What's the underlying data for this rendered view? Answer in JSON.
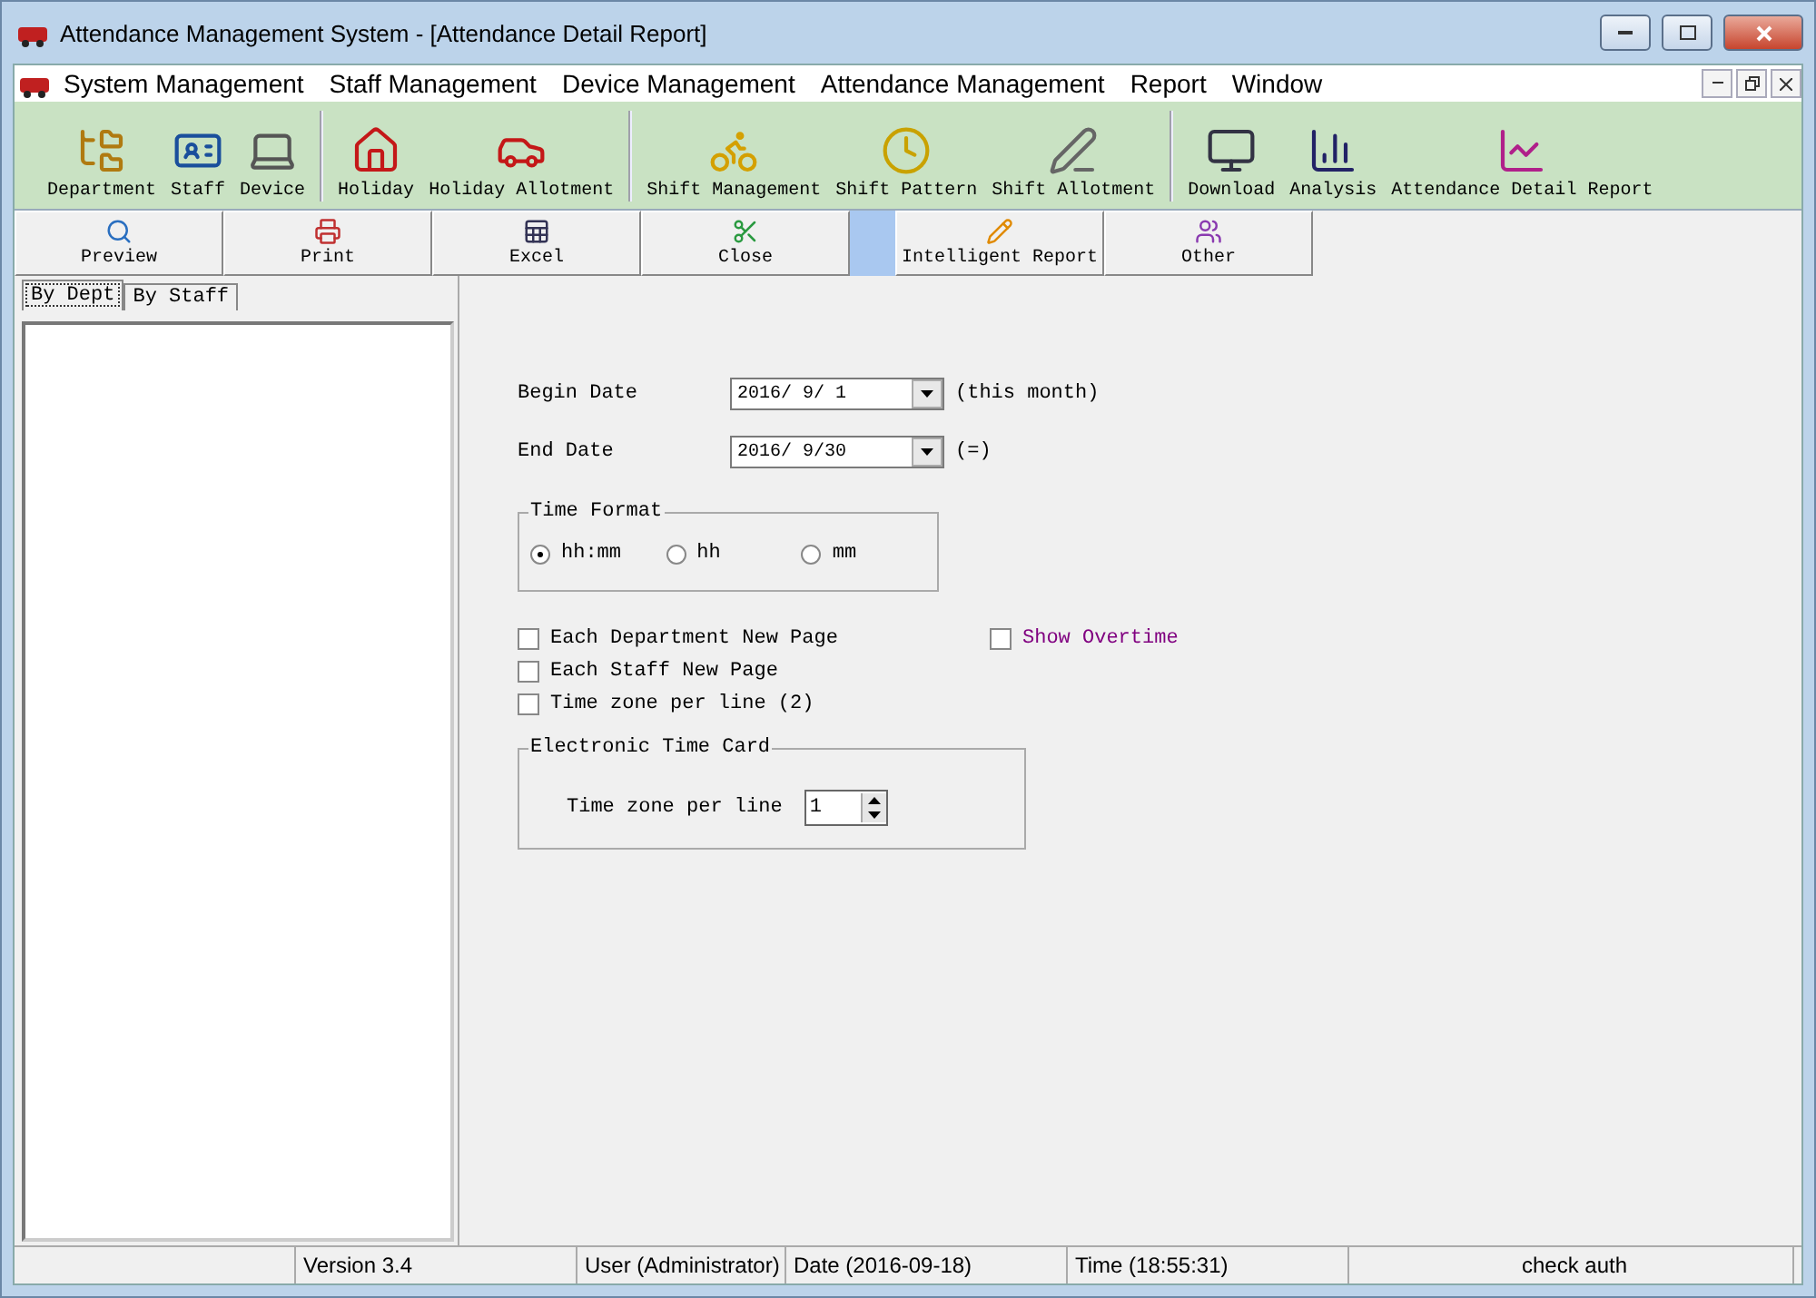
{
  "window": {
    "title": "Attendance Management System - [Attendance Detail Report]"
  },
  "menu": [
    "System Management",
    "Staff Management",
    "Device Management",
    "Attendance Management",
    "Report",
    "Window"
  ],
  "toolbar_groups": [
    {
      "items": [
        "Department",
        "Staff",
        "Device"
      ]
    },
    {
      "items": [
        "Holiday",
        "Holiday Allotment"
      ]
    },
    {
      "items": [
        "Shift Management",
        "Shift Pattern",
        "Shift Allotment"
      ]
    },
    {
      "items": [
        "Download",
        "Analysis",
        "Attendance Detail Report"
      ]
    }
  ],
  "report_buttons": [
    {
      "label": "Preview"
    },
    {
      "label": "Print"
    },
    {
      "label": "Excel"
    },
    {
      "label": "Close"
    },
    {
      "label": "Intelligent Report",
      "gap_before": true
    },
    {
      "label": "Other"
    }
  ],
  "side_tabs": [
    {
      "label": "By Dept",
      "selected": true
    },
    {
      "label": "By Staff",
      "selected": false
    }
  ],
  "begin_date": {
    "label": "Begin Date",
    "value": "2016/ 9/ 1",
    "note": "(this month)"
  },
  "end_date": {
    "label": "End Date",
    "value": "2016/ 9/30",
    "note": "(=)"
  },
  "time_format": {
    "title": "Time Format",
    "options": [
      {
        "label": "hh:mm",
        "selected": true
      },
      {
        "label": "hh",
        "selected": false
      },
      {
        "label": "mm",
        "selected": false
      }
    ]
  },
  "checkboxes": [
    {
      "label": "Each Department New Page",
      "checked": false
    },
    {
      "label": "Each Staff New Page",
      "checked": false
    },
    {
      "label": "Time zone per line (2)",
      "checked": false
    }
  ],
  "show_overtime": {
    "label": "Show Overtime",
    "checked": false
  },
  "time_card": {
    "title": "Electronic Time Card",
    "label": "Time zone per line",
    "value": "1"
  },
  "status_bar": [
    "Version 3.4",
    "User (Administrator)",
    "Date (2016-09-18)",
    "Time (18:55:31)",
    "check auth"
  ]
}
